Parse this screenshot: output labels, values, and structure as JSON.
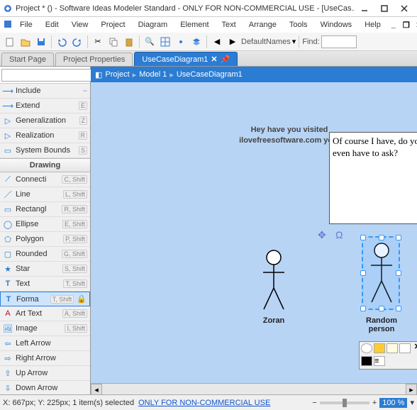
{
  "window": {
    "title": "Project *  ()  - Software Ideas Modeler Standard - ONLY FOR NON-COMMERCIAL USE - [UseCas..."
  },
  "menu": {
    "items": [
      "File",
      "Edit",
      "View",
      "Project",
      "Diagram",
      "Element",
      "Text",
      "Arrange",
      "Tools",
      "Windows",
      "Help"
    ]
  },
  "toolbar": {
    "default_names_label": "DefaultNames",
    "find_label": "Find:"
  },
  "tabs": {
    "start": "Start Page",
    "props": "Project Properties",
    "diagram": "UseCaseDiagram1"
  },
  "breadcrumb": {
    "items": [
      "Project",
      "Model 1",
      "UseCaseDiagram1"
    ]
  },
  "tools": {
    "section_drawing": "Drawing",
    "items": [
      {
        "label": "Include",
        "hint": ""
      },
      {
        "label": "Extend",
        "hint": "E"
      },
      {
        "label": "Generalization",
        "hint": "Z"
      },
      {
        "label": "Realization",
        "hint": "R"
      },
      {
        "label": "System Bounds",
        "hint": "S"
      }
    ],
    "drawing": [
      {
        "label": "Connecti",
        "hint": "C, Shift"
      },
      {
        "label": "Line",
        "hint": "L, Shift"
      },
      {
        "label": "Rectangl",
        "hint": "R, Shift"
      },
      {
        "label": "Ellipse",
        "hint": "E, Shift"
      },
      {
        "label": "Polygon",
        "hint": "P, Shift"
      },
      {
        "label": "Rounded",
        "hint": "G, Shift"
      },
      {
        "label": "Star",
        "hint": "S, Shift"
      },
      {
        "label": "Text",
        "hint": "T, Shift"
      },
      {
        "label": "Forma",
        "hint": "T, Shift",
        "selected": true
      },
      {
        "label": "Art Text",
        "hint": "A, Shift"
      },
      {
        "label": "Image",
        "hint": "I, Shift"
      },
      {
        "label": "Left Arrow",
        "hint": ""
      },
      {
        "label": "Right Arrow",
        "hint": ""
      },
      {
        "label": "Up Arrow",
        "hint": ""
      },
      {
        "label": "Down Arrow",
        "hint": ""
      }
    ]
  },
  "canvas": {
    "comment": "Hey have you visited ilovefreesoftware.com yet?",
    "note": "Of course I have, do you even have to ask?",
    "actor1_label": "Zoran",
    "actor2_label": "Random person"
  },
  "status": {
    "coords": "X: 667px; Y: 225px; 1 item(s) selected",
    "license": "ONLY FOR NON-COMMERCIAL USE",
    "zoom": "100 %"
  }
}
